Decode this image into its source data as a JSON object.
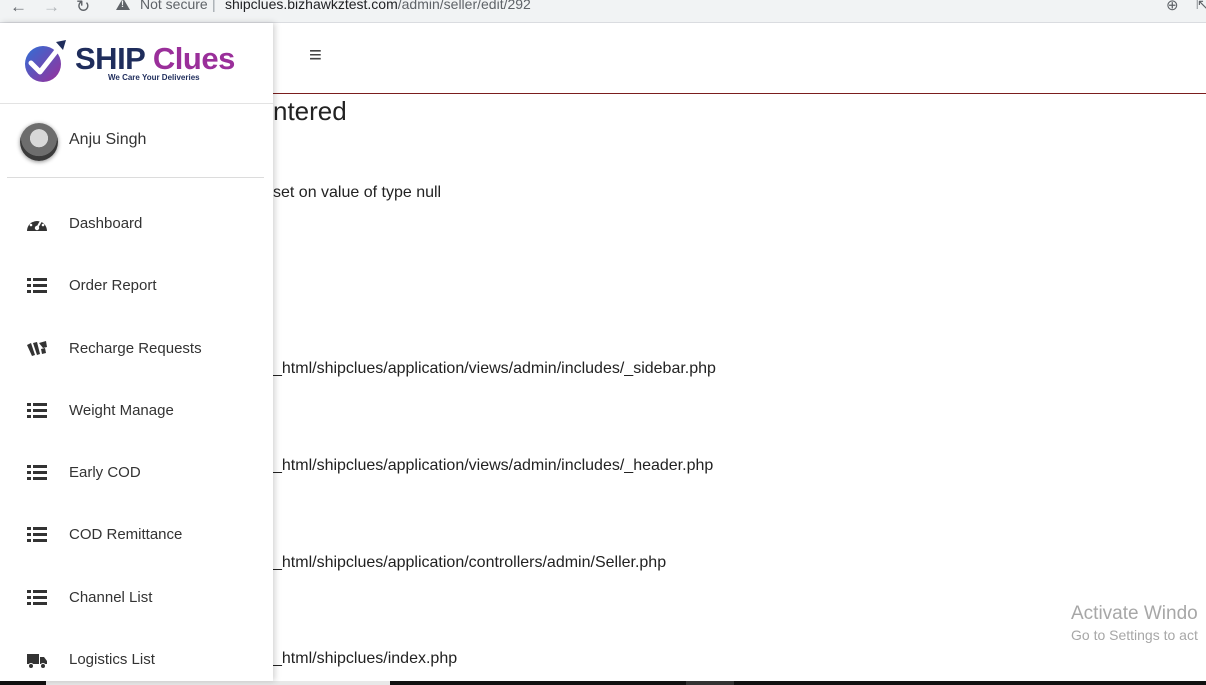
{
  "browser": {
    "security_label": "Not secure",
    "separator": "|",
    "url_host": "shipclues.bizhawkztest.com",
    "url_path": "/admin/seller/edit/292",
    "back_glyph": "←",
    "forward_glyph": "→",
    "reload_glyph": "↻",
    "zoom_glyph": "⊕",
    "share_glyph": "⇱"
  },
  "header": {
    "menu_glyph": "≡"
  },
  "brand": {
    "name_part1": "SHIP",
    "name_part2": "Clues",
    "tagline": "We Care Your Deliveries",
    "colors": {
      "navy": "#1f2d5c",
      "purple": "#9a2f9a",
      "blue": "#2f6fd6"
    }
  },
  "user": {
    "name": "Anju Singh"
  },
  "sidebar": {
    "items": [
      {
        "label": "Dashboard",
        "icon": "dashboard-icon"
      },
      {
        "label": "Order Report",
        "icon": "list-icon"
      },
      {
        "label": "Recharge Requests",
        "icon": "wallet-icon"
      },
      {
        "label": "Weight Manage",
        "icon": "list-icon"
      },
      {
        "label": "Early COD",
        "icon": "list-icon"
      },
      {
        "label": "COD Remittance",
        "icon": "list-icon"
      },
      {
        "label": "Channel List",
        "icon": "list-icon"
      },
      {
        "label": "Logistics List",
        "icon": "truck-icon"
      }
    ]
  },
  "error": {
    "heading": "ntered",
    "message": "set on value of type null",
    "paths": [
      "_html/shipclues/application/views/admin/includes/_sidebar.php",
      "_html/shipclues/application/views/admin/includes/_header.php",
      "_html/shipclues/application/controllers/admin/Seller.php",
      "_html/shipclues/index.php"
    ]
  },
  "watermark": {
    "line1": "Activate Windo",
    "line2": "Go to Settings to act"
  }
}
